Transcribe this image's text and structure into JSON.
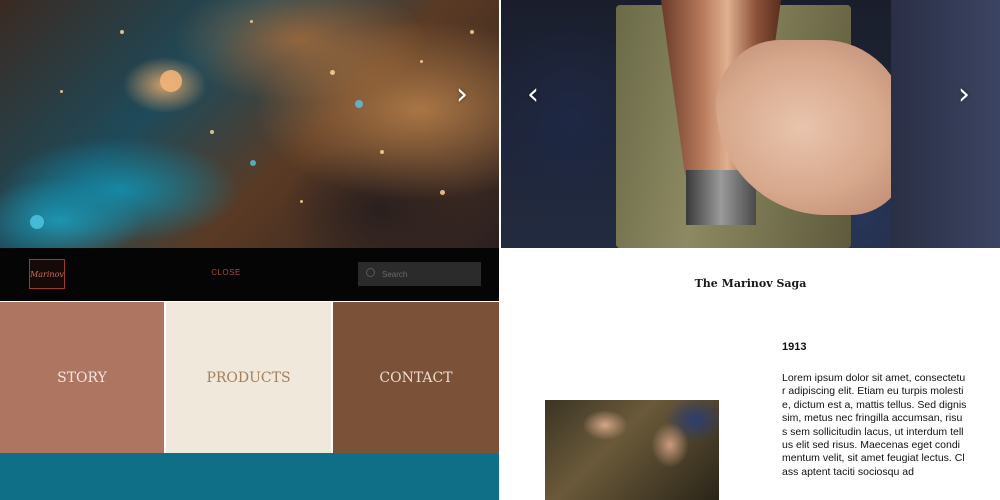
{
  "hero": {
    "left_next_arrow": "›",
    "right_prev_arrow": "‹",
    "right_next_arrow": "›"
  },
  "navbar": {
    "logo_text": "Marinov",
    "close_label": "CLOSE",
    "search_placeholder": "Search"
  },
  "tiles": [
    {
      "label": "STORY",
      "color": "#ae7660"
    },
    {
      "label": "PRODUCTS",
      "color": "#efe8db"
    },
    {
      "label": "CONTACT",
      "color": "#7b5138"
    }
  ],
  "content": {
    "title": "The Marinov Saga",
    "year": "1913",
    "body": "Lorem ipsum dolor sit amet, consectetur adipiscing elit. Etiam eu turpis molestie, dictum est a, mattis tellus. Sed dignissim, metus nec fringilla accumsan, risus sem sollicitudin lacus, ut interdum tellus elit sed risus. Maecenas eget condimentum velit, sit amet feugiat lectus. Class aptent taciti sociosqu ad"
  },
  "colors": {
    "teal_band": "#0e6f86",
    "navbar_bg": "#050505"
  }
}
